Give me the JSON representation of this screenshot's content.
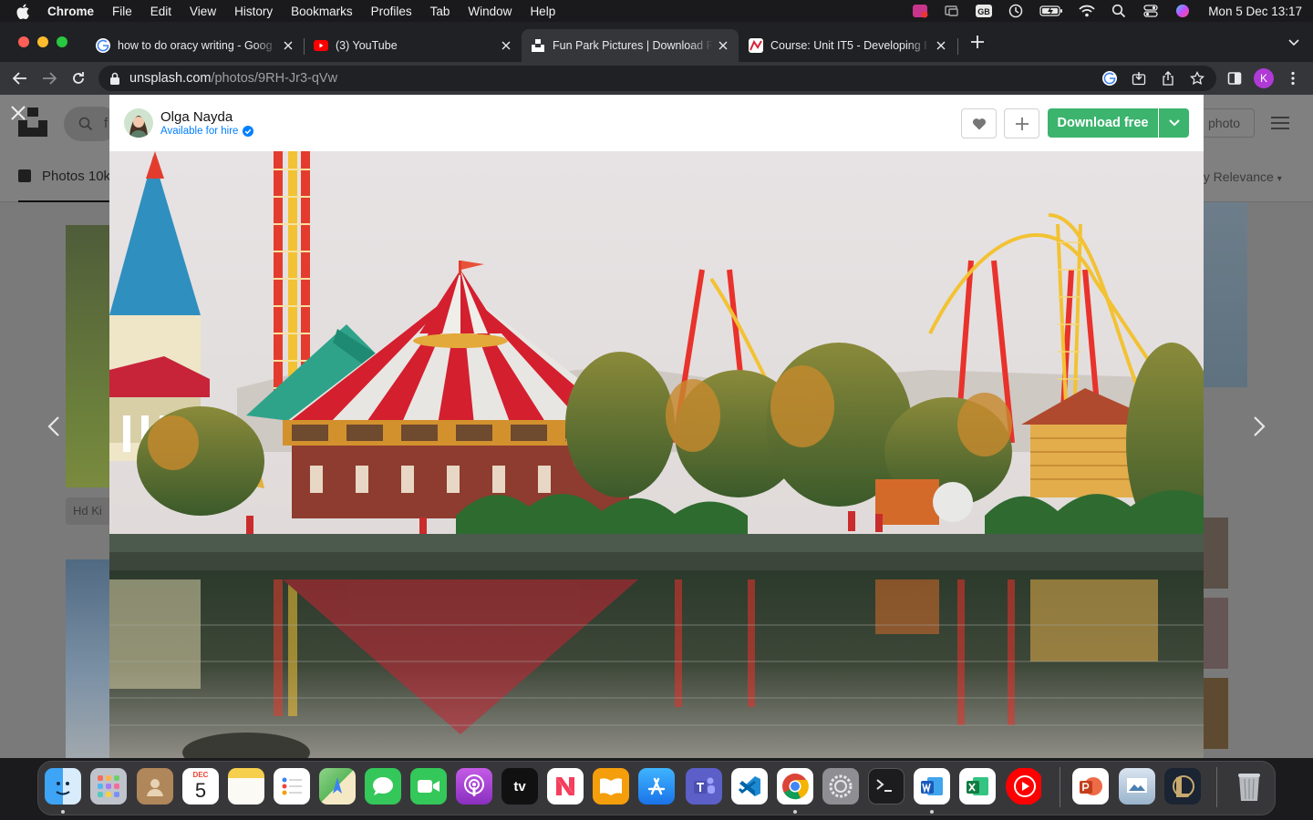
{
  "menubar": {
    "app_name": "Chrome",
    "items": [
      "File",
      "Edit",
      "View",
      "History",
      "Bookmarks",
      "Profiles",
      "Tab",
      "Window",
      "Help"
    ],
    "clock": "Mon 5 Dec  13:17",
    "status_icons": [
      "creative-cloud-icon",
      "display-icon",
      "keyboard-layout-icon",
      "time-machine-icon",
      "battery-icon",
      "wifi-icon",
      "spotlight-icon",
      "control-center-icon",
      "siri-icon"
    ],
    "keyboard_layout": "GB"
  },
  "tabs": [
    {
      "title": "how to do oracy writing - Goog",
      "favicon": "google-icon",
      "active": false
    },
    {
      "title": "(3) YouTube",
      "favicon": "youtube-icon",
      "active": false
    },
    {
      "title": "Fun Park Pictures | Download F",
      "favicon": "unsplash-icon",
      "active": true
    },
    {
      "title": "Course: Unit IT5 - Developing I",
      "favicon": "moodle-icon",
      "active": false
    }
  ],
  "address": {
    "host": "unsplash.com",
    "path": "/photos/9RH-Jr3-qVw"
  },
  "profile_initial": "K",
  "background_page": {
    "search_text": "f",
    "photos_tab": "Photos 10k",
    "submit_label": "photo",
    "sort_label": "by Relevance",
    "tag_label": "Hd Ki"
  },
  "modal": {
    "photographer": "Olga Nayda",
    "hire_status": "Available for hire",
    "download_label": "Download free",
    "like_icon": "heart-icon",
    "collect_icon": "plus-icon"
  },
  "dock": {
    "apps": [
      "Finder",
      "Launchpad",
      "Contacts",
      "Calendar",
      "Notes",
      "Reminders",
      "Maps",
      "Messages",
      "FaceTime",
      "Podcasts",
      "TV",
      "News",
      "Books",
      "App Store",
      "Teams",
      "VS Code",
      "Chrome",
      "System Preferences",
      "Terminal",
      "Word",
      "Excel",
      "YouTube Music",
      "PowerPoint",
      "Preview",
      "League of Legends",
      "Trash"
    ],
    "calendar_month": "DEC",
    "calendar_day": "5",
    "tv_label": "tv"
  }
}
